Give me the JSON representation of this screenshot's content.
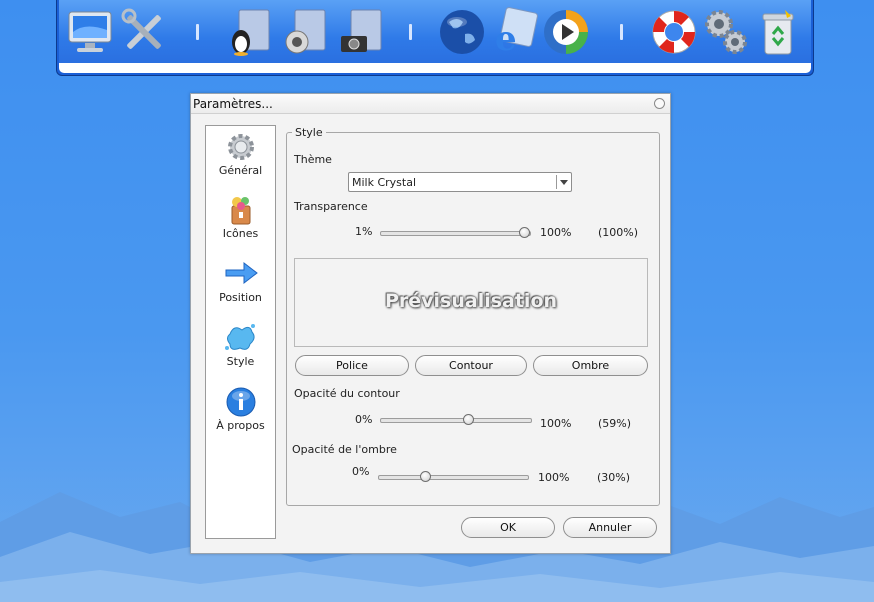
{
  "dock": {
    "icons": [
      "monitor-icon",
      "tools-icon",
      "tux-folder-icon",
      "audio-folder-icon",
      "photo-folder-icon",
      "globe-icon",
      "internet-explorer-icon",
      "media-player-icon",
      "lifebuoy-icon",
      "gears-icon",
      "recycle-bin-icon"
    ]
  },
  "dialog": {
    "title": "Paramètres...",
    "sidebar": [
      {
        "label": "Général",
        "icon": "gear-icon"
      },
      {
        "label": "Icônes",
        "icon": "icons-icon"
      },
      {
        "label": "Position",
        "icon": "arrow-icon"
      },
      {
        "label": "Style",
        "icon": "paint-splash-icon"
      },
      {
        "label": "À propos",
        "icon": "info-icon"
      }
    ],
    "group_title": "Style",
    "theme": {
      "label": "Thème",
      "value": "Milk Crystal"
    },
    "transparency": {
      "label": "Transparence",
      "min": "1%",
      "max": "100%",
      "current": "(100%)",
      "fraction": 1.0
    },
    "preview_text": "Prévisualisation",
    "buttons": {
      "font": "Police",
      "outline": "Contour",
      "shadow": "Ombre"
    },
    "outline_opacity": {
      "label": "Opacité du contour",
      "min": "0%",
      "max": "100%",
      "current": "(59%)",
      "fraction": 0.59
    },
    "shadow_opacity": {
      "label": "Opacité de l'ombre",
      "min": "0%",
      "max": "100%",
      "current": "(30%)",
      "fraction": 0.3
    },
    "ok_label": "OK",
    "cancel_label": "Annuler"
  }
}
